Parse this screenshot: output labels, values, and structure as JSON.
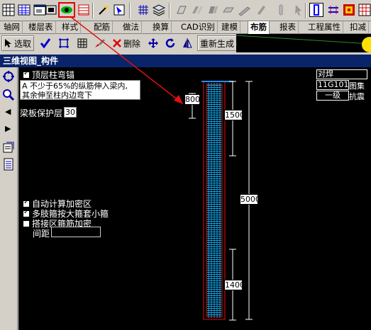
{
  "toolbar1": {
    "icons": [
      "grid-icon",
      "table-icon",
      "window-icon",
      "eye-3d-icon",
      "rebar-icon",
      "wand-icon",
      "pick-icon",
      "grid-axis-icon",
      "layers-icon",
      "column-icon",
      "beam-icon",
      "wall-icon",
      "slab-icon",
      "stair-icon",
      "pen-icon",
      "text-icon",
      "rebar-column-icon",
      "rebar-beam-icon",
      "color-icon",
      "palette-icon"
    ]
  },
  "tabs": [
    "轴网",
    "楼层表",
    "样式",
    "配筋",
    "做法",
    "换算",
    "CAD识别",
    "建模",
    "布筋",
    "报表",
    "工程属性",
    "扣减"
  ],
  "active_tab": "布筋",
  "toolbar2": {
    "select_label": "选取",
    "delete_label": "删除",
    "regenerate_label": "重新生成"
  },
  "panel": {
    "title": "三维视图_构件",
    "top_anchor_checkbox": "顶层柱弯锚",
    "anchor_desc_line1": "A 不少于65%的纵筋伸入梁内,",
    "anchor_desc_line2": "其余伸至柱内边弯下",
    "cover_label": "梁板保护层",
    "cover_value": "30",
    "auto_calc": "自动计算加密区",
    "multi_stirrup": "多肢箍按大箍套小箍",
    "lap_zone": "搭接区箍筋加密",
    "spacing_label": "间距",
    "spacing_value": "",
    "weld_label": "对焊",
    "atlas_value": "11G101",
    "atlas_label": "图集",
    "seismic_value": "一级",
    "seismic_label": "抗震"
  },
  "dimensions": {
    "d800": "800",
    "d1500": "1500",
    "d5000": "5000",
    "d1400": "1400"
  }
}
